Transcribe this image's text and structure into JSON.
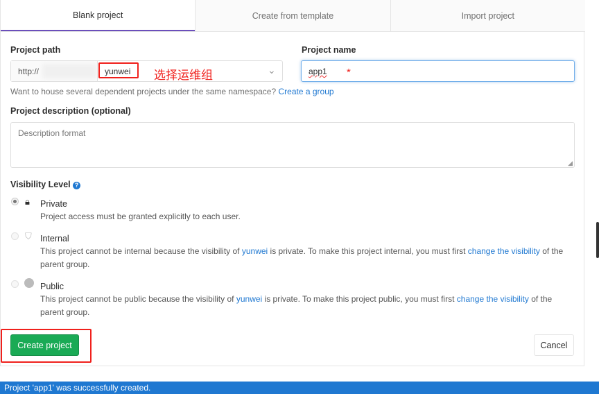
{
  "tabs": [
    {
      "label": "Blank project",
      "active": true
    },
    {
      "label": "Create from template"
    },
    {
      "label": "Import project"
    }
  ],
  "project_path": {
    "label": "Project path",
    "prefix": "http://",
    "namespace": "yunwei",
    "annotation": "选择运维组"
  },
  "project_name": {
    "label": "Project name",
    "value": "app1",
    "required_mark": "*"
  },
  "group_hint": {
    "text": "Want to house several dependent projects under the same namespace?",
    "link": "Create a group"
  },
  "description": {
    "label": "Project description (optional)",
    "placeholder": "Description format"
  },
  "visibility": {
    "label": "Visibility Level",
    "options": [
      {
        "title": "Private",
        "selected": true,
        "icon": "lock-icon",
        "desc": "Project access must be granted explicitly to each user."
      },
      {
        "title": "Internal",
        "icon": "shield-icon",
        "desc_pre": "This project cannot be internal because the visibility of",
        "group": "yunwei",
        "desc_mid": "is private. To make this project internal, you must first",
        "link": "change the visibility",
        "desc_post": "of the parent group."
      },
      {
        "title": "Public",
        "icon": "globe-icon",
        "desc_pre": "This project cannot be public because the visibility of",
        "group": "yunwei",
        "desc_mid": "is private. To make this project public, you must first",
        "link": "change the visibility",
        "desc_post": "of the parent group."
      }
    ]
  },
  "buttons": {
    "create": "Create project",
    "cancel": "Cancel"
  },
  "flash": {
    "text": "Project 'app1' was successfully created."
  },
  "colors": {
    "accent": "#6b4fbb",
    "success": "#1aaa55",
    "flash": "#1f78d1",
    "annotation": "#f0201c"
  }
}
